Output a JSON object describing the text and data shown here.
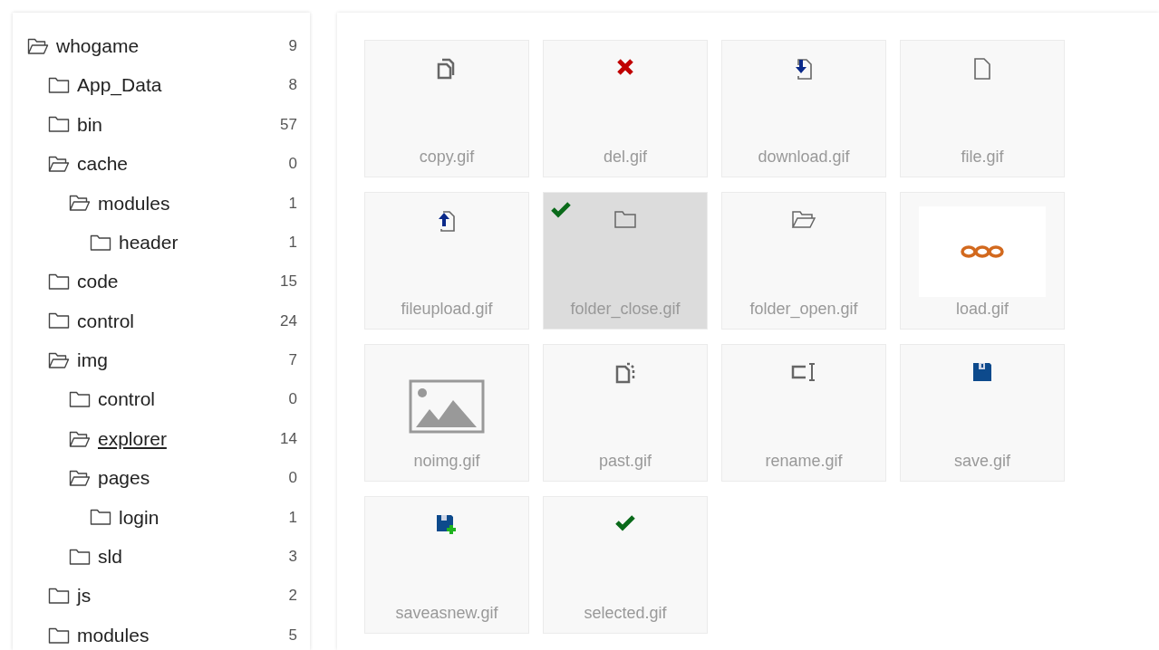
{
  "tree": [
    {
      "label": "whogame",
      "count": "9",
      "expanded": true,
      "selected": false,
      "children": [
        {
          "label": "App_Data",
          "count": "8",
          "expanded": false,
          "selected": false
        },
        {
          "label": "bin",
          "count": "57",
          "expanded": false,
          "selected": false
        },
        {
          "label": "cache",
          "count": "0",
          "expanded": true,
          "selected": false,
          "children": [
            {
              "label": "modules",
              "count": "1",
              "expanded": true,
              "selected": false,
              "children": [
                {
                  "label": "header",
                  "count": "1",
                  "expanded": false,
                  "selected": false
                }
              ]
            }
          ]
        },
        {
          "label": "code",
          "count": "15",
          "expanded": false,
          "selected": false
        },
        {
          "label": "control",
          "count": "24",
          "expanded": false,
          "selected": false
        },
        {
          "label": "img",
          "count": "7",
          "expanded": true,
          "selected": false,
          "children": [
            {
              "label": "control",
              "count": "0",
              "expanded": false,
              "selected": false
            },
            {
              "label": "explorer",
              "count": "14",
              "expanded": true,
              "selected": true
            },
            {
              "label": "pages",
              "count": "0",
              "expanded": true,
              "selected": false,
              "children": [
                {
                  "label": "login",
                  "count": "1",
                  "expanded": false,
                  "selected": false
                }
              ]
            },
            {
              "label": "sld",
              "count": "3",
              "expanded": false,
              "selected": false
            }
          ]
        },
        {
          "label": "js",
          "count": "2",
          "expanded": false,
          "selected": false
        },
        {
          "label": "modules",
          "count": "5",
          "expanded": false,
          "selected": false
        }
      ]
    }
  ],
  "files": [
    {
      "name": "copy.gif",
      "kind": "copy",
      "selected": false
    },
    {
      "name": "del.gif",
      "kind": "delete",
      "selected": false
    },
    {
      "name": "download.gif",
      "kind": "download",
      "selected": false
    },
    {
      "name": "file.gif",
      "kind": "file",
      "selected": false
    },
    {
      "name": "fileupload.gif",
      "kind": "upload",
      "selected": false
    },
    {
      "name": "folder_close.gif",
      "kind": "folder",
      "selected": true
    },
    {
      "name": "folder_open.gif",
      "kind": "folderopen",
      "selected": false
    },
    {
      "name": "load.gif",
      "kind": "loader",
      "selected": false
    },
    {
      "name": "noimg.gif",
      "kind": "noimage",
      "selected": false
    },
    {
      "name": "past.gif",
      "kind": "paste",
      "selected": false
    },
    {
      "name": "rename.gif",
      "kind": "rename",
      "selected": false
    },
    {
      "name": "save.gif",
      "kind": "save",
      "selected": false
    },
    {
      "name": "saveasnew.gif",
      "kind": "savenew",
      "selected": false
    },
    {
      "name": "selected.gif",
      "kind": "check",
      "selected": false
    }
  ]
}
